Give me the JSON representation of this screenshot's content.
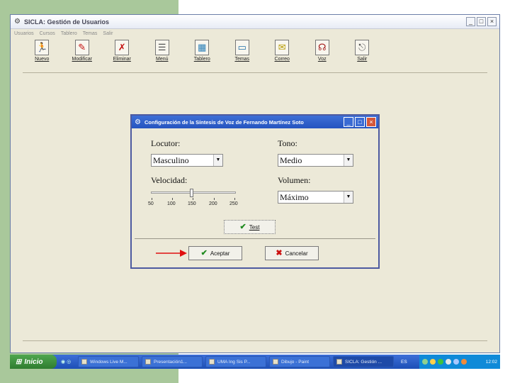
{
  "window": {
    "title": "SICLA: Gestión de Usuarios"
  },
  "menu": [
    "Usuarios",
    "Cursos",
    "Tablero",
    "Temas",
    "Salir"
  ],
  "toolbar": [
    {
      "label": "Nuevo",
      "icon": "new-user-icon",
      "glyph": "🏃"
    },
    {
      "label": "Modificar",
      "icon": "edit-user-icon",
      "glyph": "✎"
    },
    {
      "label": "Eliminar",
      "icon": "delete-user-icon",
      "glyph": "✗"
    },
    {
      "label": "Menú",
      "icon": "menu-icon",
      "glyph": "☰"
    },
    {
      "label": "Tablero",
      "icon": "board-icon",
      "glyph": "▦"
    },
    {
      "label": "Temas",
      "icon": "topics-icon",
      "glyph": "▭"
    },
    {
      "label": "Correo",
      "icon": "mail-icon",
      "glyph": "✉"
    },
    {
      "label": "Voz",
      "icon": "voice-icon",
      "glyph": "☊"
    },
    {
      "label": "Salir",
      "icon": "exit-door-icon",
      "glyph": "⎋"
    }
  ],
  "dialog": {
    "title": "Configuración de la Síntesis de Voz de Fernando Martínez Soto",
    "locutor_label": "Locutor:",
    "locutor_value": "Masculino",
    "tono_label": "Tono:",
    "tono_value": "Medio",
    "velocidad_label": "Velocidad:",
    "volumen_label": "Volumen:",
    "volumen_value": "Máximo",
    "slider_ticks": [
      "50",
      "100",
      "150",
      "200",
      "250"
    ],
    "slider_value": 145,
    "test_label": "Test",
    "accept_label": "Aceptar",
    "cancel_label": "Cancelar"
  },
  "taskbar": {
    "start_label": "Inicio",
    "tasks": [
      {
        "label": "Windows Live M...",
        "active": false
      },
      {
        "label": "Presentación1...",
        "active": false
      },
      {
        "label": "UMA Ing Sis P...",
        "active": false
      },
      {
        "label": "Dibujo - Paint",
        "active": false
      },
      {
        "label": "SICLA: Gestión ...",
        "active": true
      }
    ],
    "lang": "ES",
    "clock": "12:02"
  },
  "colors": {
    "green_bg": "#a9c89b",
    "title_blue": "#2554c0",
    "accept_green": "#1f8a1f",
    "cancel_red": "#cc1111"
  }
}
